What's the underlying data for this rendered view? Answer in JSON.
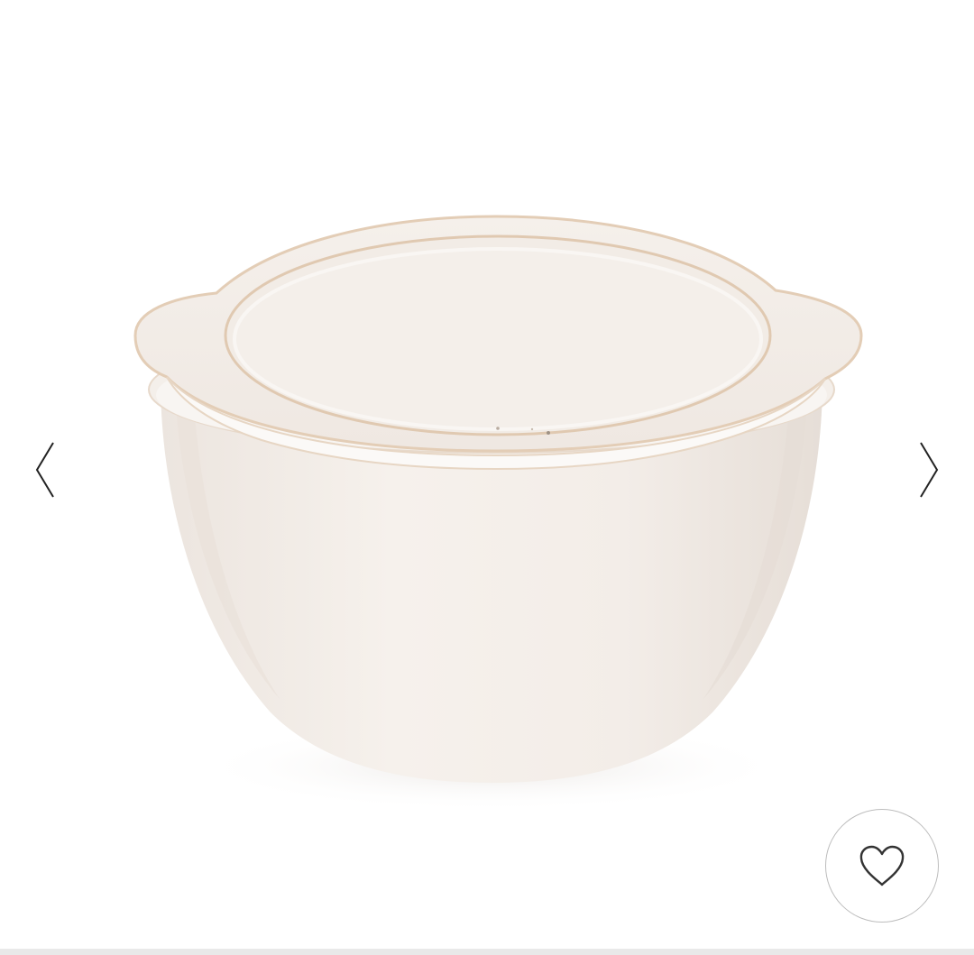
{
  "gallery": {
    "image": {
      "icon": "covered-ceramic-bowl-photo",
      "glaze_color": "#f3eee9",
      "rim_color": "#e2cdb8"
    },
    "prev_icon": "chevron-left-icon",
    "next_icon": "chevron-right-icon"
  },
  "favorite": {
    "icon": "heart-outline-icon",
    "border_color": "#bdbdbd"
  }
}
